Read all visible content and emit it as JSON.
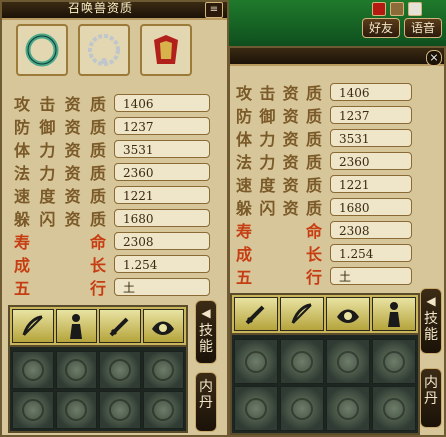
{
  "top_bar": {
    "buttons": [
      "好友",
      "语音"
    ],
    "gems": [
      {
        "name": "heart-icon",
        "color": "#b51a12"
      },
      {
        "name": "gear-icon",
        "color": "#8b6b38"
      },
      {
        "name": "bag-icon",
        "color": "#e7e2d8"
      }
    ]
  },
  "left_panel": {
    "title": "召唤兽资质",
    "menu_icon": "≡",
    "equipment_icons": [
      "ring-icon",
      "necklace-icon",
      "armor-icon"
    ],
    "stats": [
      {
        "label": [
          "攻",
          "击",
          "资",
          "质"
        ],
        "value": "1406"
      },
      {
        "label": [
          "防",
          "御",
          "资",
          "质"
        ],
        "value": "1237"
      },
      {
        "label": [
          "体",
          "力",
          "资",
          "质"
        ],
        "value": "3531"
      },
      {
        "label": [
          "法",
          "力",
          "资",
          "质"
        ],
        "value": "2360"
      },
      {
        "label": [
          "速",
          "度",
          "资",
          "质"
        ],
        "value": "1221"
      },
      {
        "label": [
          "躲",
          "闪",
          "资",
          "质"
        ],
        "value": "1680"
      },
      {
        "label": [
          "寿",
          "",
          "",
          "命"
        ],
        "value": "2308",
        "red": true
      },
      {
        "label": [
          "成",
          "",
          "",
          "长"
        ],
        "value": "1.254",
        "red": true
      },
      {
        "label": [
          "五",
          "",
          "",
          "行"
        ],
        "value": "土",
        "red": true
      }
    ],
    "skill_icons": [
      "bow-icon",
      "figure-icon",
      "sword-icon",
      "eye-icon"
    ],
    "side_buttons": [
      {
        "arrow": "◀",
        "text": "技能"
      },
      {
        "arrow": "",
        "text": "内丹"
      }
    ]
  },
  "right_panel": {
    "title": "",
    "close": "×",
    "stats": [
      {
        "label": [
          "攻",
          "击",
          "资",
          "质"
        ],
        "value": "1406"
      },
      {
        "label": [
          "防",
          "御",
          "资",
          "质"
        ],
        "value": "1237"
      },
      {
        "label": [
          "体",
          "力",
          "资",
          "质"
        ],
        "value": "3531"
      },
      {
        "label": [
          "法",
          "力",
          "资",
          "质"
        ],
        "value": "2360"
      },
      {
        "label": [
          "速",
          "度",
          "资",
          "质"
        ],
        "value": "1221"
      },
      {
        "label": [
          "躲",
          "闪",
          "资",
          "质"
        ],
        "value": "1680"
      },
      {
        "label": [
          "寿",
          "",
          "",
          "命"
        ],
        "value": "2308",
        "red": true
      },
      {
        "label": [
          "成",
          "",
          "",
          "长"
        ],
        "value": "1.254",
        "red": true
      },
      {
        "label": [
          "五",
          "",
          "",
          "行"
        ],
        "value": "土",
        "red": true
      }
    ],
    "skill_icons": [
      "sword-icon",
      "bow-icon",
      "eye-icon",
      "figure-icon"
    ],
    "side_buttons": [
      {
        "arrow": "◀",
        "text": "技能"
      },
      {
        "arrow": "",
        "text": "内丹"
      }
    ]
  }
}
